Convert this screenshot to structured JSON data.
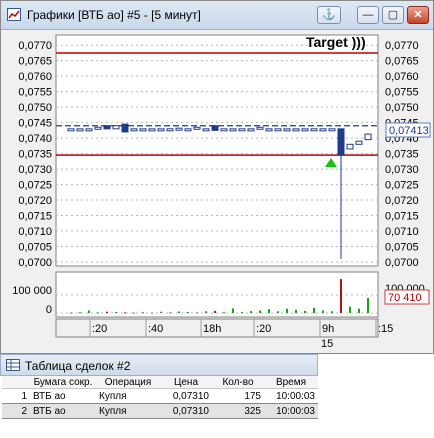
{
  "window": {
    "title": "Графики [ВТБ ао] #5 - [5 минут]",
    "buttons": {
      "anchor": "⚓",
      "minimize": "—",
      "maximize": "▢",
      "close": "✕"
    }
  },
  "annotation": "Target )))",
  "price_axis": {
    "ticks": [
      "0,0770",
      "0,0765",
      "0,0760",
      "0,0755",
      "0,0750",
      "0,0745",
      "0,0740",
      "0,0735",
      "0,0730",
      "0,0725",
      "0,0720",
      "0,0715",
      "0,0710",
      "0,0705",
      "0,0700"
    ],
    "current_price": "0,07413"
  },
  "volume_axis": {
    "ticks": [
      "100 000",
      "0"
    ],
    "right_top": "100 000",
    "current_volume": "70 410"
  },
  "time_axis": {
    "labels": [
      ":20",
      ":40",
      "18h",
      ":20",
      "9h",
      ":15"
    ],
    "sublabel": "15"
  },
  "chart_data": {
    "type": "candlestick",
    "ylim": [
      0.07,
      0.0772
    ],
    "lines": [
      {
        "value": 0.07675,
        "color": "#c00000"
      },
      {
        "value": 0.07345,
        "color": "#c00000"
      },
      {
        "value": 0.0744,
        "color": "#1f3b8a",
        "style": "dashed"
      }
    ],
    "candles": [
      {
        "o": 0.0743,
        "c": 0.0743,
        "h": 0.0743,
        "l": 0.0743,
        "v": 2000
      },
      {
        "o": 0.0743,
        "c": 0.0743,
        "h": 0.0743,
        "l": 0.0743,
        "v": 4000
      },
      {
        "o": 0.0743,
        "c": 0.0743,
        "h": 0.0743,
        "l": 0.0743,
        "v": 12000
      },
      {
        "o": 0.0743,
        "c": 0.07435,
        "h": 0.07435,
        "l": 0.0743,
        "v": 3000
      },
      {
        "o": 0.0744,
        "c": 0.0743,
        "h": 0.0744,
        "l": 0.0743,
        "v": 6000
      },
      {
        "o": 0.0743,
        "c": 0.0744,
        "h": 0.0744,
        "l": 0.0743,
        "v": 5000
      },
      {
        "o": 0.07445,
        "c": 0.0742,
        "h": 0.07445,
        "l": 0.0742,
        "v": 3000
      },
      {
        "o": 0.0743,
        "c": 0.0743,
        "h": 0.0743,
        "l": 0.0743,
        "v": 2000
      },
      {
        "o": 0.0743,
        "c": 0.0743,
        "h": 0.0743,
        "l": 0.0743,
        "v": 4000
      },
      {
        "o": 0.0743,
        "c": 0.0743,
        "h": 0.0743,
        "l": 0.0743,
        "v": 2000
      },
      {
        "o": 0.0743,
        "c": 0.0743,
        "h": 0.0743,
        "l": 0.0743,
        "v": 6000
      },
      {
        "o": 0.0743,
        "c": 0.0743,
        "h": 0.0743,
        "l": 0.0743,
        "v": 3000
      },
      {
        "o": 0.07432,
        "c": 0.07432,
        "h": 0.07432,
        "l": 0.07432,
        "v": 7000
      },
      {
        "o": 0.0743,
        "c": 0.0743,
        "h": 0.0743,
        "l": 0.0743,
        "v": 5000
      },
      {
        "o": 0.07435,
        "c": 0.07435,
        "h": 0.07435,
        "l": 0.07435,
        "v": 3000
      },
      {
        "o": 0.0743,
        "c": 0.0743,
        "h": 0.0743,
        "l": 0.0743,
        "v": 8000
      },
      {
        "o": 0.0744,
        "c": 0.07425,
        "h": 0.0744,
        "l": 0.07425,
        "v": 10000
      },
      {
        "o": 0.0743,
        "c": 0.0743,
        "h": 0.0743,
        "l": 0.0743,
        "v": 4000
      },
      {
        "o": 0.0743,
        "c": 0.0743,
        "h": 0.0743,
        "l": 0.0743,
        "v": 22000
      },
      {
        "o": 0.0743,
        "c": 0.0743,
        "h": 0.0743,
        "l": 0.0743,
        "v": 5000
      },
      {
        "o": 0.0743,
        "c": 0.0743,
        "h": 0.0743,
        "l": 0.0743,
        "v": 9000
      },
      {
        "o": 0.07435,
        "c": 0.07435,
        "h": 0.07435,
        "l": 0.07435,
        "v": 12000
      },
      {
        "o": 0.0743,
        "c": 0.0743,
        "h": 0.0743,
        "l": 0.0743,
        "v": 18000
      },
      {
        "o": 0.0743,
        "c": 0.0743,
        "h": 0.0743,
        "l": 0.0743,
        "v": 8000
      },
      {
        "o": 0.0743,
        "c": 0.0743,
        "h": 0.0743,
        "l": 0.0743,
        "v": 20000
      },
      {
        "o": 0.0743,
        "c": 0.0743,
        "h": 0.0743,
        "l": 0.0743,
        "v": 15000
      },
      {
        "o": 0.0743,
        "c": 0.0743,
        "h": 0.0743,
        "l": 0.0743,
        "v": 10000
      },
      {
        "o": 0.0743,
        "c": 0.0743,
        "h": 0.0743,
        "l": 0.0743,
        "v": 25000
      },
      {
        "o": 0.0743,
        "c": 0.0743,
        "h": 0.0743,
        "l": 0.0743,
        "v": 12000
      },
      {
        "o": 0.0743,
        "c": 0.0743,
        "h": 0.0743,
        "l": 0.0743,
        "v": 8000
      },
      {
        "o": 0.0743,
        "c": 0.07345,
        "h": 0.0743,
        "l": 0.0701,
        "v": 160000
      },
      {
        "o": 0.07365,
        "c": 0.0738,
        "h": 0.0738,
        "l": 0.07365,
        "v": 30000
      },
      {
        "o": 0.0738,
        "c": 0.0739,
        "h": 0.0739,
        "l": 0.0738,
        "v": 20000
      },
      {
        "o": 0.07395,
        "c": 0.07413,
        "h": 0.07413,
        "l": 0.07395,
        "v": 70410
      }
    ],
    "volume_ylim": [
      0,
      170000
    ]
  },
  "deals": {
    "title": "Таблица сделок #2",
    "columns": [
      "Бумага сокр.",
      "Операция",
      "Цена",
      "Кол-во",
      "Время"
    ],
    "rows": [
      {
        "n": "1",
        "security": "ВТБ ао",
        "op": "Купля",
        "price": "0,07310",
        "qty": "175",
        "time": "10:00:03"
      },
      {
        "n": "2",
        "security": "ВТБ ао",
        "op": "Купля",
        "price": "0,07310",
        "qty": "325",
        "time": "10:00:03"
      }
    ]
  }
}
